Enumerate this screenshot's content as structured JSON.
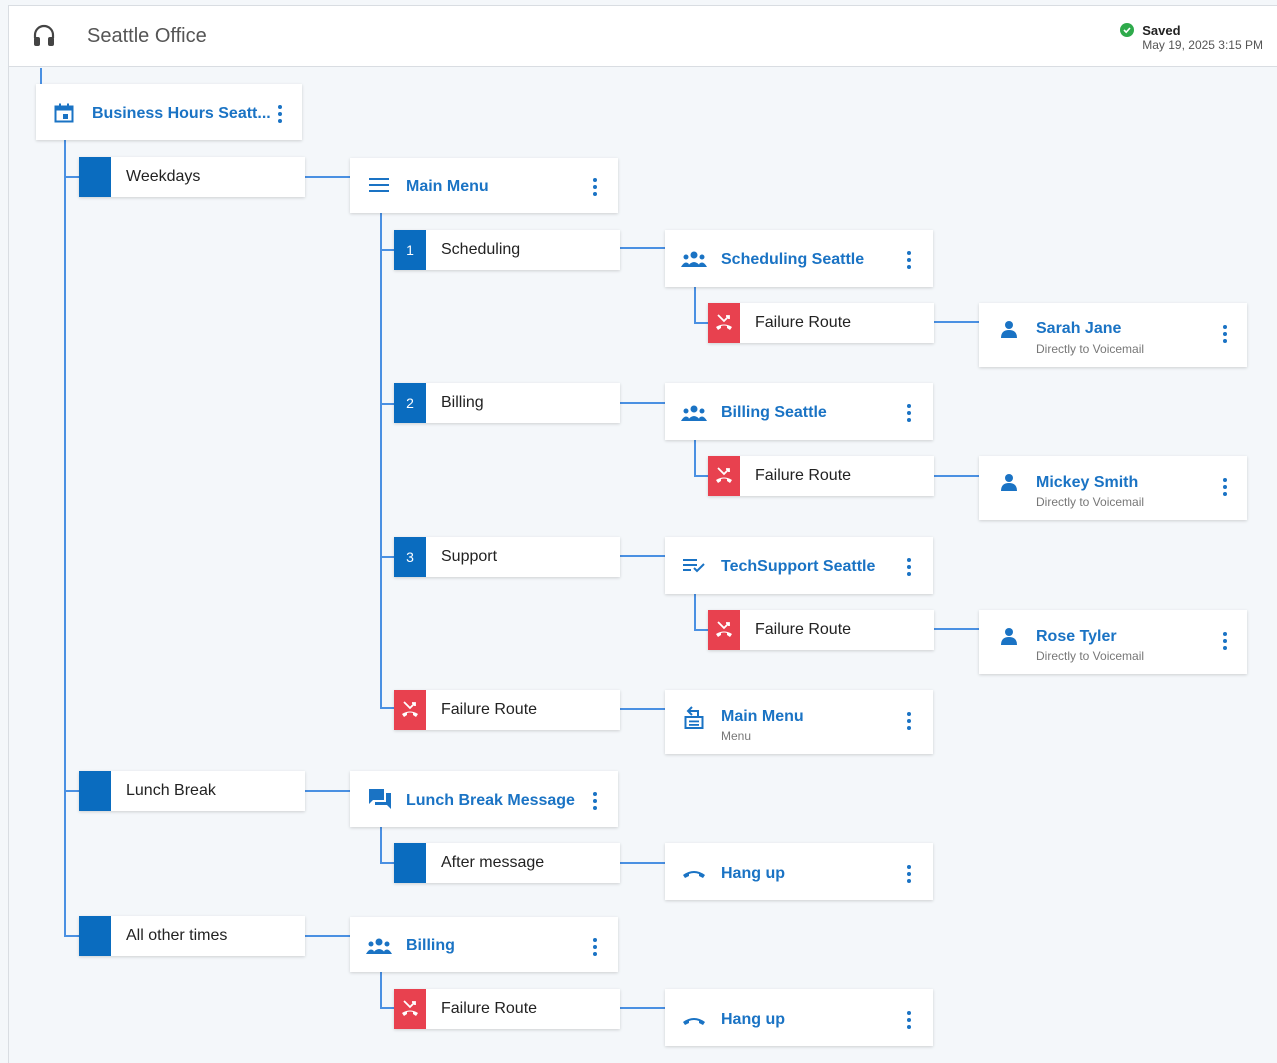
{
  "header": {
    "title": "Seattle Office",
    "status": "Saved",
    "timestamp": "May 19, 2025 3:15 PM"
  },
  "schedule": {
    "title": "Business Hours Seatt..."
  },
  "routes": {
    "weekdays": "Weekdays",
    "lunch": "Lunch Break",
    "other": "All other times",
    "failure": "Failure Route",
    "after_message": "After message",
    "opt1": "Scheduling",
    "opt2": "Billing",
    "opt3": "Support",
    "num1": "1",
    "num2": "2",
    "num3": "3"
  },
  "nodes": {
    "main_menu": "Main Menu",
    "sched_seattle": "Scheduling Seattle",
    "billing_seattle": "Billing Seattle",
    "tech_seattle": "TechSupport Seattle",
    "main_menu_2": "Main Menu",
    "main_menu_2_sub": "Menu",
    "lunch_msg": "Lunch Break Message",
    "hangup_1": "Hang up",
    "billing": "Billing",
    "hangup_2": "Hang up",
    "sarah": "Sarah Jane",
    "mickey": "Mickey Smith",
    "rose": "Rose Tyler",
    "voicemail": "Directly to Voicemail"
  },
  "colors": {
    "accent": "#1a73c4",
    "route_flag": "#0a6cbf",
    "failure": "#e8414f",
    "connector": "#4a90e2",
    "saved_ok": "#2eaa4b"
  }
}
